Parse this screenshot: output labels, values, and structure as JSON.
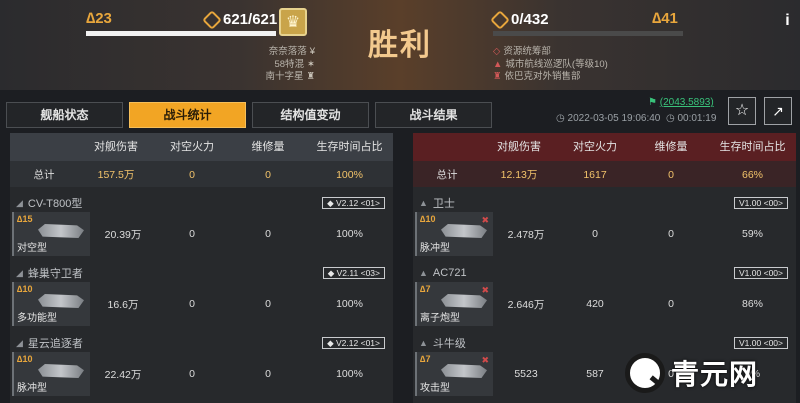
{
  "header": {
    "player_level": "23",
    "player_resource": "621/621",
    "player_info": [
      "奈奈落落",
      "58特混",
      "南十字星"
    ],
    "title": "胜利",
    "enemy_resource": "0/432",
    "enemy_level": "41",
    "enemy_info": [
      "资源统筹部",
      "城市航线巡逻队(等级10)",
      "依巴克对外销售部"
    ],
    "info_button": "i"
  },
  "tabs": [
    {
      "label": "舰船状态",
      "active": false
    },
    {
      "label": "战斗统计",
      "active": true
    },
    {
      "label": "结构值变动",
      "active": false
    },
    {
      "label": "战斗结果",
      "active": false
    }
  ],
  "meta": {
    "net_value": "(2043.5893)",
    "timestamp": "2022-03-05 19:06:40",
    "duration": "00:01:19"
  },
  "columns": [
    "对舰伤害",
    "对空火力",
    "维修量",
    "生存时间占比"
  ],
  "left": {
    "total_label": "总计",
    "totals": [
      "157.5万",
      "0",
      "0",
      "100%"
    ],
    "ships": [
      {
        "name": "CV-T800型",
        "version": "V2.12",
        "version_tag": "01",
        "level": "15",
        "type": "对空型",
        "values": [
          "20.39万",
          "0",
          "0",
          "100%"
        ]
      },
      {
        "name": "蜂巢守卫者",
        "version": "V2.11",
        "version_tag": "03",
        "level": "10",
        "type": "多功能型",
        "values": [
          "16.6万",
          "0",
          "0",
          "100%"
        ]
      },
      {
        "name": "星云追逐者",
        "version": "V2.12",
        "version_tag": "01",
        "level": "10",
        "type": "脉冲型",
        "values": [
          "22.42万",
          "0",
          "0",
          "100%"
        ]
      }
    ]
  },
  "right": {
    "total_label": "总计",
    "totals": [
      "12.13万",
      "1617",
      "0",
      "66%"
    ],
    "ships": [
      {
        "name": "卫士",
        "version": "V1.00",
        "version_tag": "00",
        "level": "10",
        "type": "脉冲型",
        "values": [
          "2.478万",
          "0",
          "0",
          "59%"
        ]
      },
      {
        "name": "AC721",
        "version": "V1.00",
        "version_tag": "00",
        "level": "7",
        "type": "离子炮型",
        "values": [
          "2.646万",
          "420",
          "0",
          "86%"
        ]
      },
      {
        "name": "斗牛级",
        "version": "V1.00",
        "version_tag": "00",
        "level": "7",
        "type": "攻击型",
        "values": [
          "5523",
          "587",
          "0",
          "0%"
        ]
      }
    ]
  },
  "watermark": {
    "text": "青元网"
  }
}
